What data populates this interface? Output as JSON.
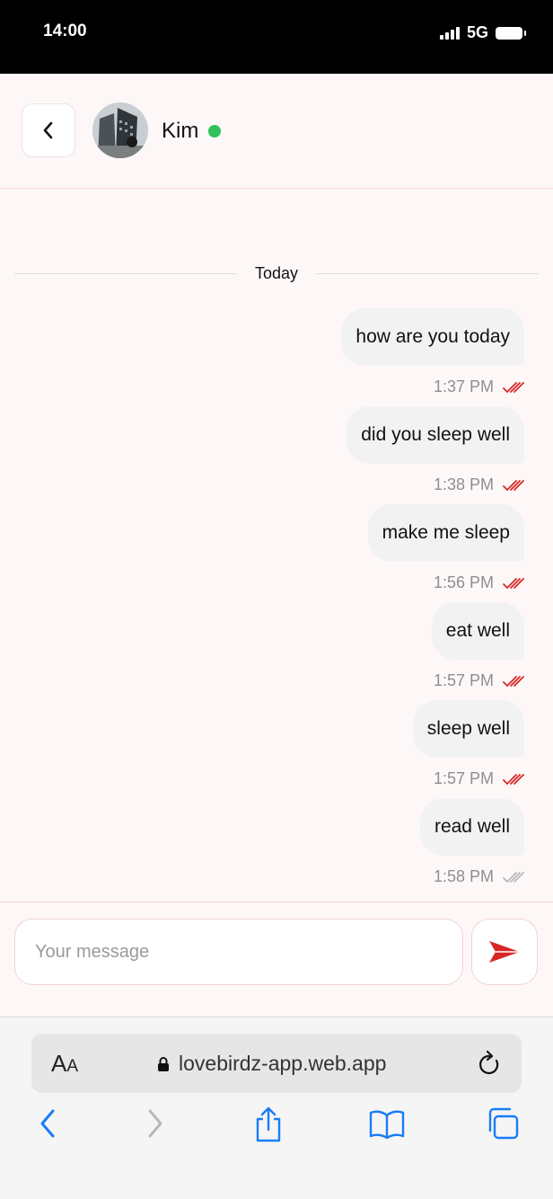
{
  "status_bar": {
    "time": "14:00",
    "network": "5G"
  },
  "header": {
    "contact_name": "Kim",
    "online": true
  },
  "chat": {
    "date_label": "Today",
    "messages": [
      {
        "text": "how are you today",
        "time": "1:37 PM",
        "status": "read"
      },
      {
        "text": "did you sleep well",
        "time": "1:38 PM",
        "status": "read"
      },
      {
        "text": "make me sleep",
        "time": "1:56 PM",
        "status": "read"
      },
      {
        "text": "eat well",
        "time": "1:57 PM",
        "status": "read"
      },
      {
        "text": "sleep well",
        "time": "1:57 PM",
        "status": "read"
      },
      {
        "text": "read well",
        "time": "1:58 PM",
        "status": "delivered"
      }
    ]
  },
  "composer": {
    "placeholder": "Your message",
    "value": ""
  },
  "browser": {
    "text_size_label_big": "A",
    "text_size_label_small": "A",
    "url": "lovebirdz-app.web.app"
  },
  "colors": {
    "accent": "#d62828",
    "online": "#2fc25b",
    "bubble": "#f2f2f2",
    "ios_blue": "#1a7cf5"
  },
  "icons": [
    "back-chevron-icon",
    "send-icon",
    "double-check-icon",
    "lock-icon",
    "reload-icon",
    "share-icon",
    "bookmarks-icon",
    "tabs-icon"
  ]
}
